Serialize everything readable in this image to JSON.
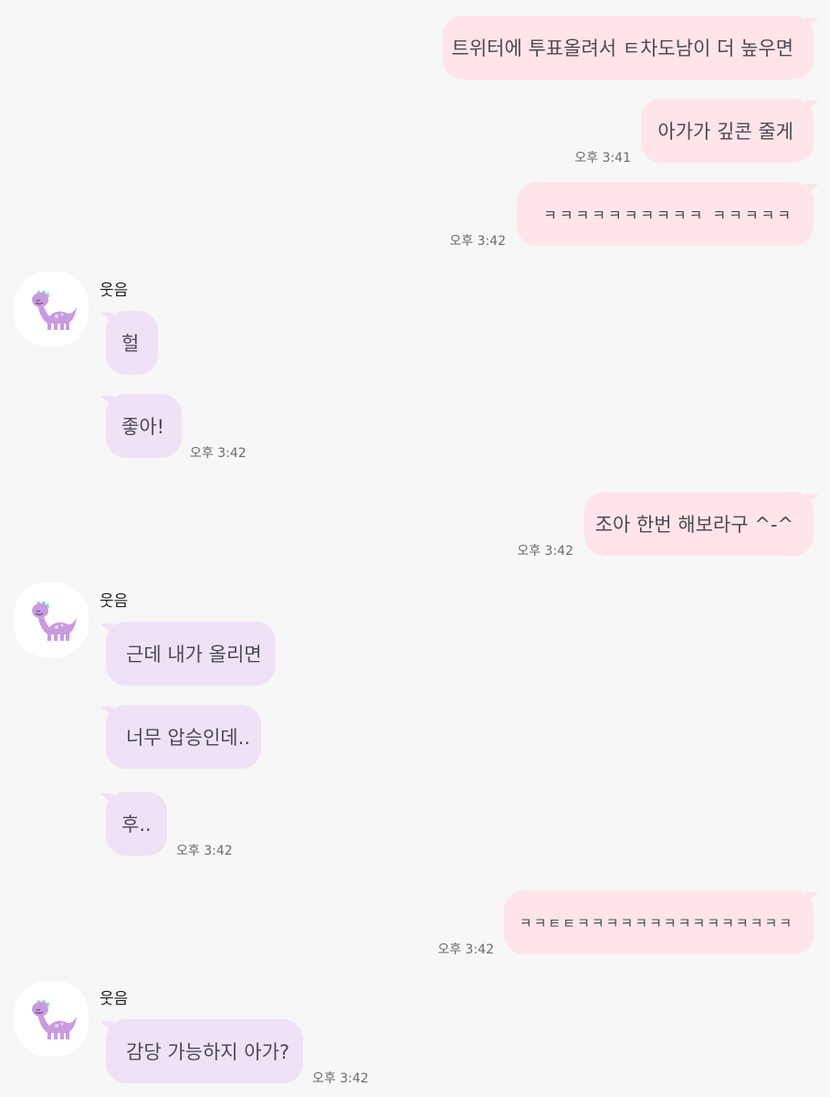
{
  "chat": {
    "sender_name": "웃음",
    "sent": [
      {
        "text": "트위터에 투표올려서 ㅌ차도남이 더 높우면",
        "time": ""
      },
      {
        "text": "아가가 깊콘 줄게",
        "time": "오후 3:41"
      },
      {
        "text": "ㅋㅋㅋㅋㅋㅋㅋㅋㅋㅋ ㅋㅋㅋㅋㅋ",
        "time": "오후 3:42"
      },
      {
        "text": "조아 한번 해보라구 ^-^",
        "time": "오후 3:42"
      },
      {
        "text": "ㅋㅋㅌㅌㅋㅋㅋㅋㅋㅋㅋㅋㅋㅋㅋㅋㅋㅋㅋ",
        "time": "오후 3:42"
      }
    ],
    "received": [
      {
        "text": "헐",
        "time": ""
      },
      {
        "text": "좋아!",
        "time": "오후 3:42"
      },
      {
        "text": "근데 내가 올리면",
        "time": ""
      },
      {
        "text": "너무 압승인데..",
        "time": ""
      },
      {
        "text": "후..",
        "time": "오후 3:42"
      },
      {
        "text": "감당 가능하지 아가?",
        "time": "오후 3:42"
      }
    ]
  }
}
